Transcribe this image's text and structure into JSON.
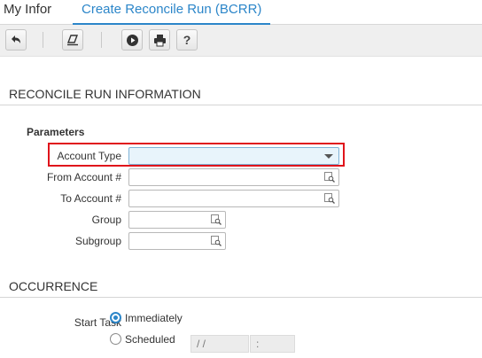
{
  "tabs": {
    "my_infor": "My Infor",
    "active": "Create Reconcile Run (BCRR)"
  },
  "toolbar": {
    "buttons": [
      {
        "icon": "undo-icon"
      },
      {
        "icon": "clear-icon"
      },
      {
        "icon": "run-icon"
      },
      {
        "icon": "print-icon"
      },
      {
        "icon": "help-icon",
        "glyph": "?"
      }
    ]
  },
  "section_reconcile": {
    "title": "RECONCILE RUN INFORMATION"
  },
  "parameters": {
    "title": "Parameters",
    "account_type": {
      "label": "Account Type",
      "value": ""
    },
    "from_account": {
      "label": "From Account #",
      "value": ""
    },
    "to_account": {
      "label": "To Account #",
      "value": ""
    },
    "group": {
      "label": "Group",
      "value": ""
    },
    "subgroup": {
      "label": "Subgroup",
      "value": ""
    }
  },
  "section_occurrence": {
    "title": "OCCURRENCE"
  },
  "start_task": {
    "label": "Start Task",
    "options": [
      {
        "label": "Immediately",
        "selected": true
      },
      {
        "label": "Scheduled",
        "selected": false
      }
    ],
    "date_placeholder": "/ /",
    "time_placeholder": ":"
  },
  "colors": {
    "accent": "#2c86c9",
    "highlight": "#e0141b"
  }
}
